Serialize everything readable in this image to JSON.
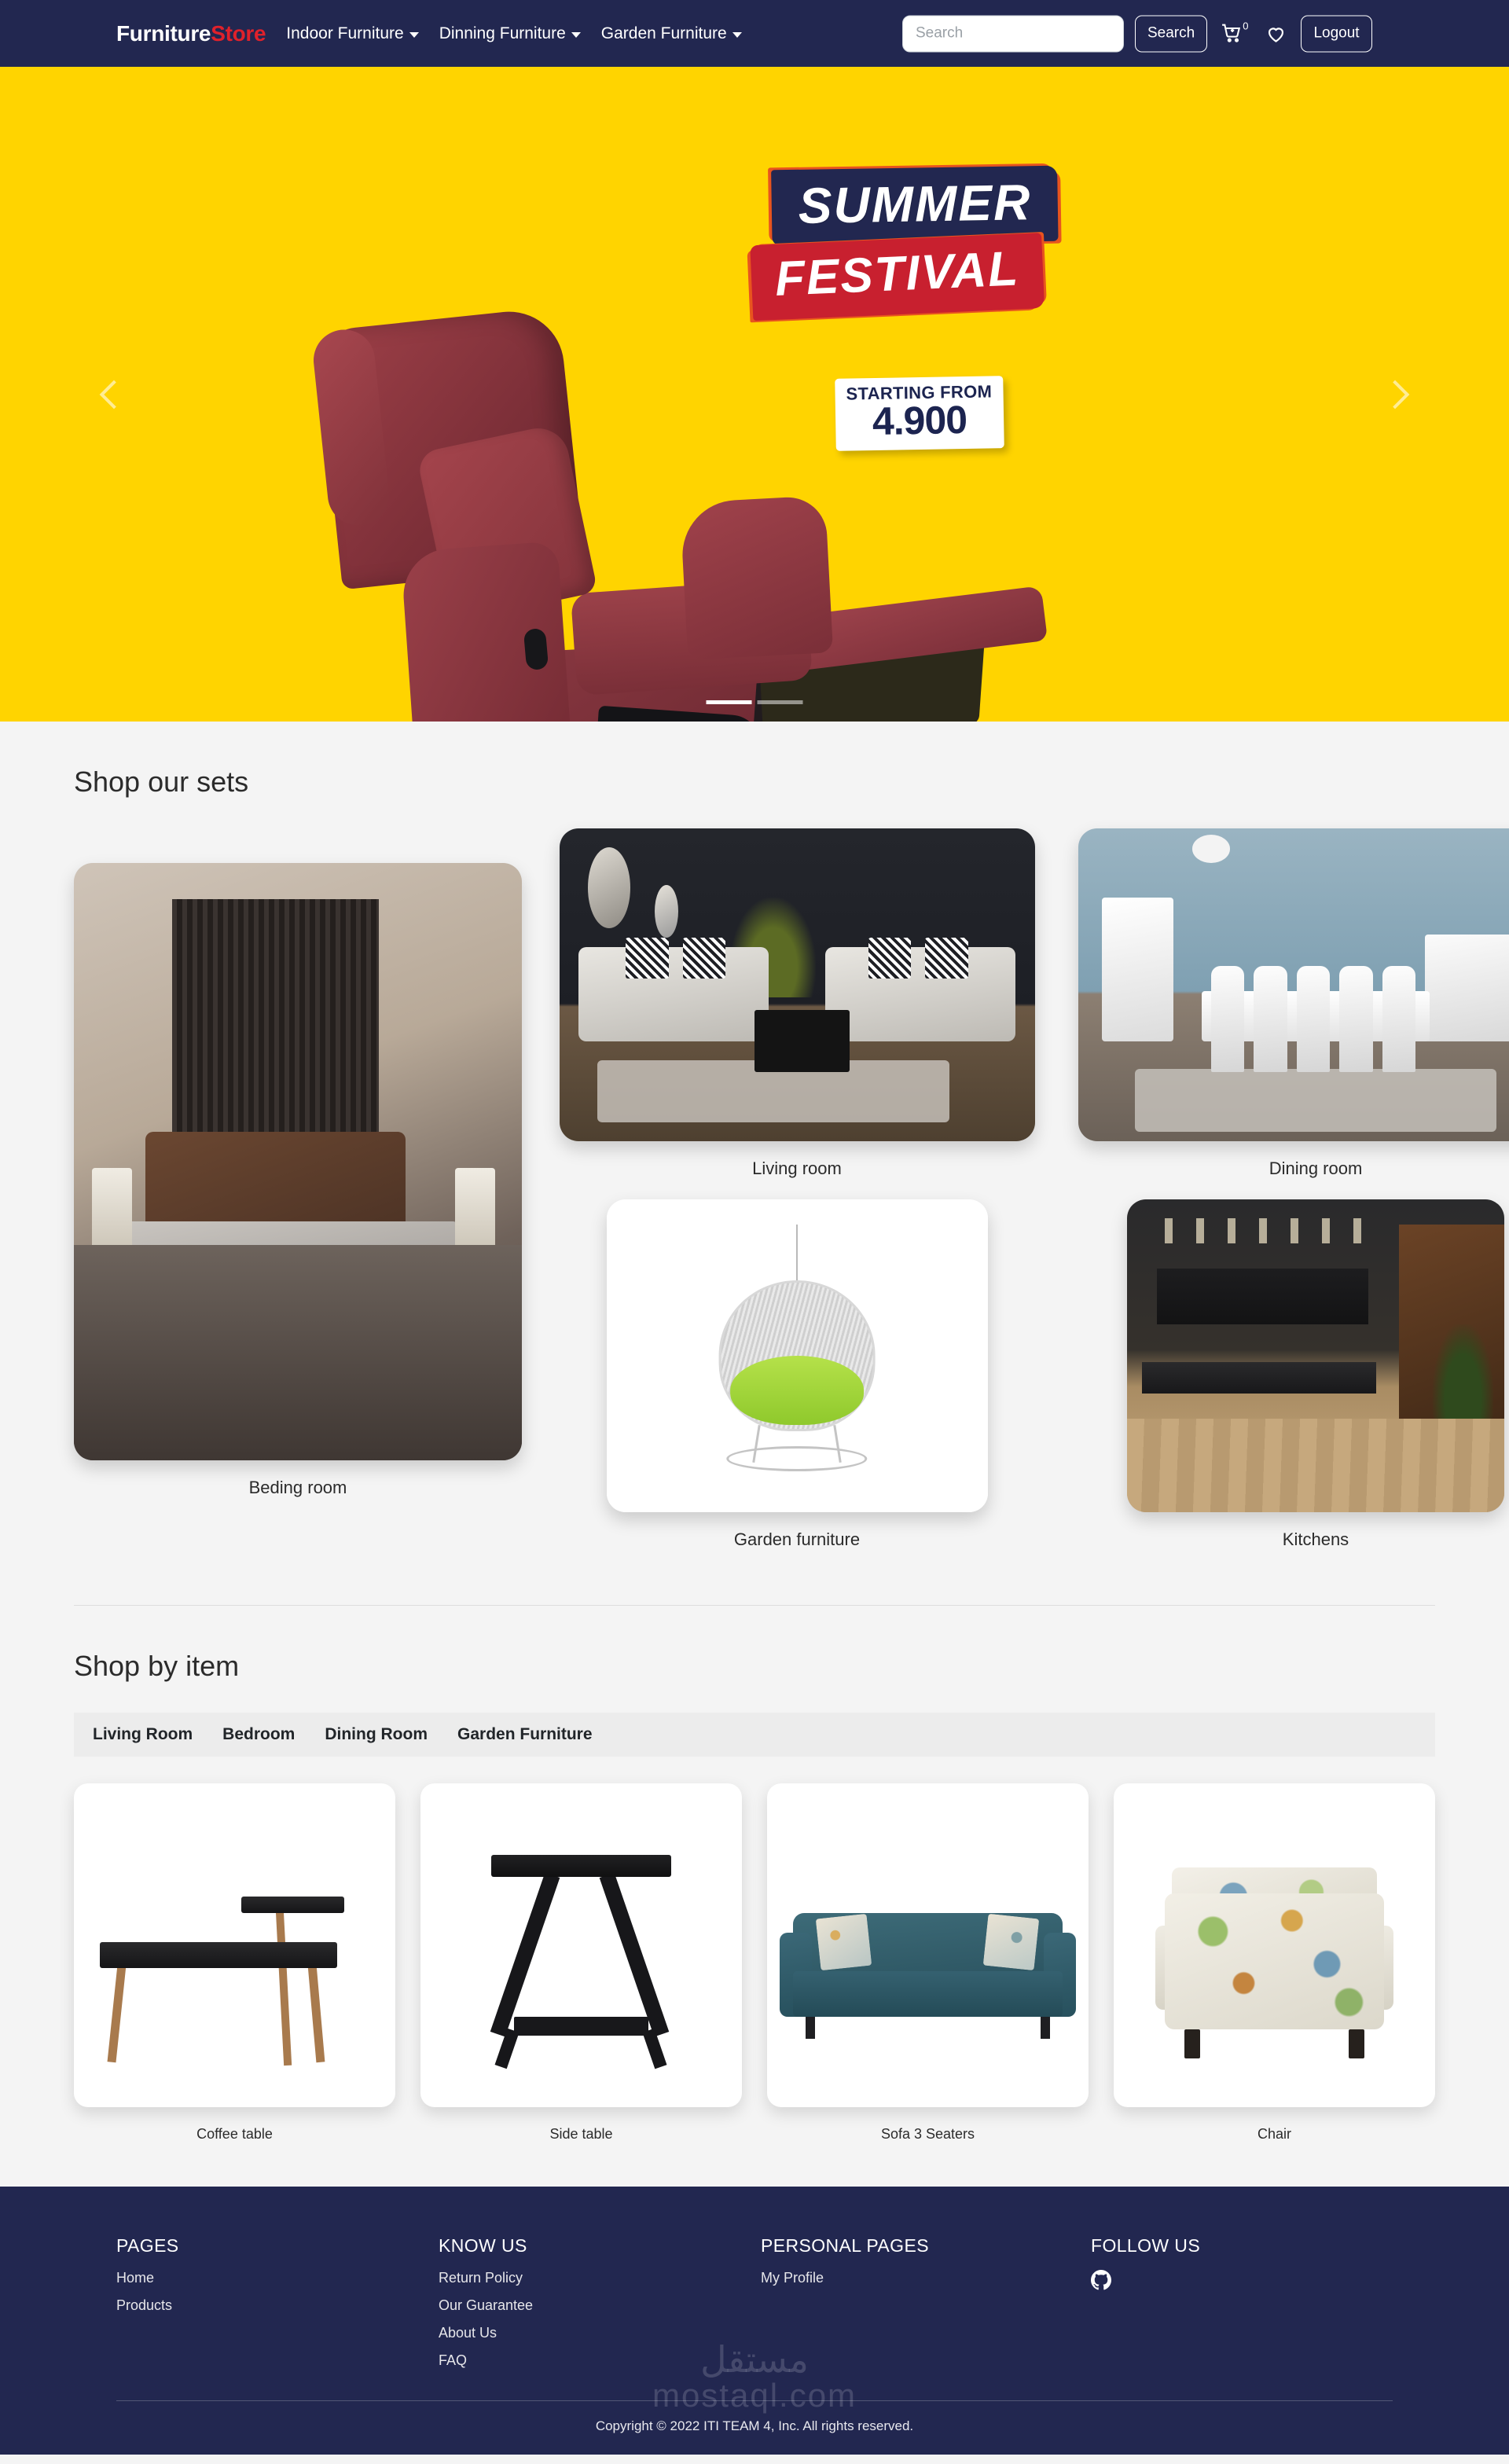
{
  "navbar": {
    "brand_first": "Furniture",
    "brand_second": "Store",
    "links": [
      {
        "label": "Indoor Furniture"
      },
      {
        "label": "Dinning Furniture"
      },
      {
        "label": "Garden Furniture"
      }
    ],
    "search_placeholder": "Search",
    "search_value": "",
    "search_button": "Search",
    "cart_count": "0",
    "logout_button": "Logout",
    "bg_color": "#222750",
    "brand_accent": "#e0212b"
  },
  "hero": {
    "headline_top": "SUMMER",
    "headline_bottom": "FESTIVAL",
    "price_label": "STARTING FROM",
    "price_value": "4.900",
    "bg_color": "#ffd400",
    "navy": "#222750",
    "red": "#c8202f",
    "prev_label": "Previous",
    "next_label": "Next",
    "indicators": [
      {
        "active": true
      },
      {
        "active": false
      }
    ]
  },
  "sets_section": {
    "title": "Shop our sets",
    "items": [
      {
        "label": "Beding room",
        "art": "bed"
      },
      {
        "label": "Living room",
        "art": "liv"
      },
      {
        "label": "Dining room",
        "art": "din"
      },
      {
        "label": "Garden furniture",
        "art": "gar"
      },
      {
        "label": "Kitchens",
        "art": "kit"
      }
    ]
  },
  "items_section": {
    "title": "Shop by item",
    "tabs": [
      {
        "label": "Living Room",
        "active": true
      },
      {
        "label": "Bedroom",
        "active": false
      },
      {
        "label": "Dining Room",
        "active": false
      },
      {
        "label": "Garden Furniture",
        "active": false
      }
    ],
    "products": [
      {
        "label": "Coffee table"
      },
      {
        "label": "Side table"
      },
      {
        "label": "Sofa 3 Seaters"
      },
      {
        "label": "Chair"
      }
    ]
  },
  "footer": {
    "columns": [
      {
        "title": "PAGES",
        "links": [
          "Home",
          "Products"
        ]
      },
      {
        "title": "KNOW US",
        "links": [
          "Return Policy",
          "Our Guarantee",
          "About Us",
          "FAQ"
        ]
      },
      {
        "title": "PERSONAL PAGES",
        "links": [
          "My Profile"
        ]
      }
    ],
    "follow_title": "FOLLOW US",
    "social_icon": "github-icon",
    "copyright": "Copyright © 2022 ITI TEAM 4, Inc. All rights reserved.",
    "watermark_ar": "مستقل",
    "watermark_en": "mostaql.com",
    "bg_color": "#222750"
  }
}
